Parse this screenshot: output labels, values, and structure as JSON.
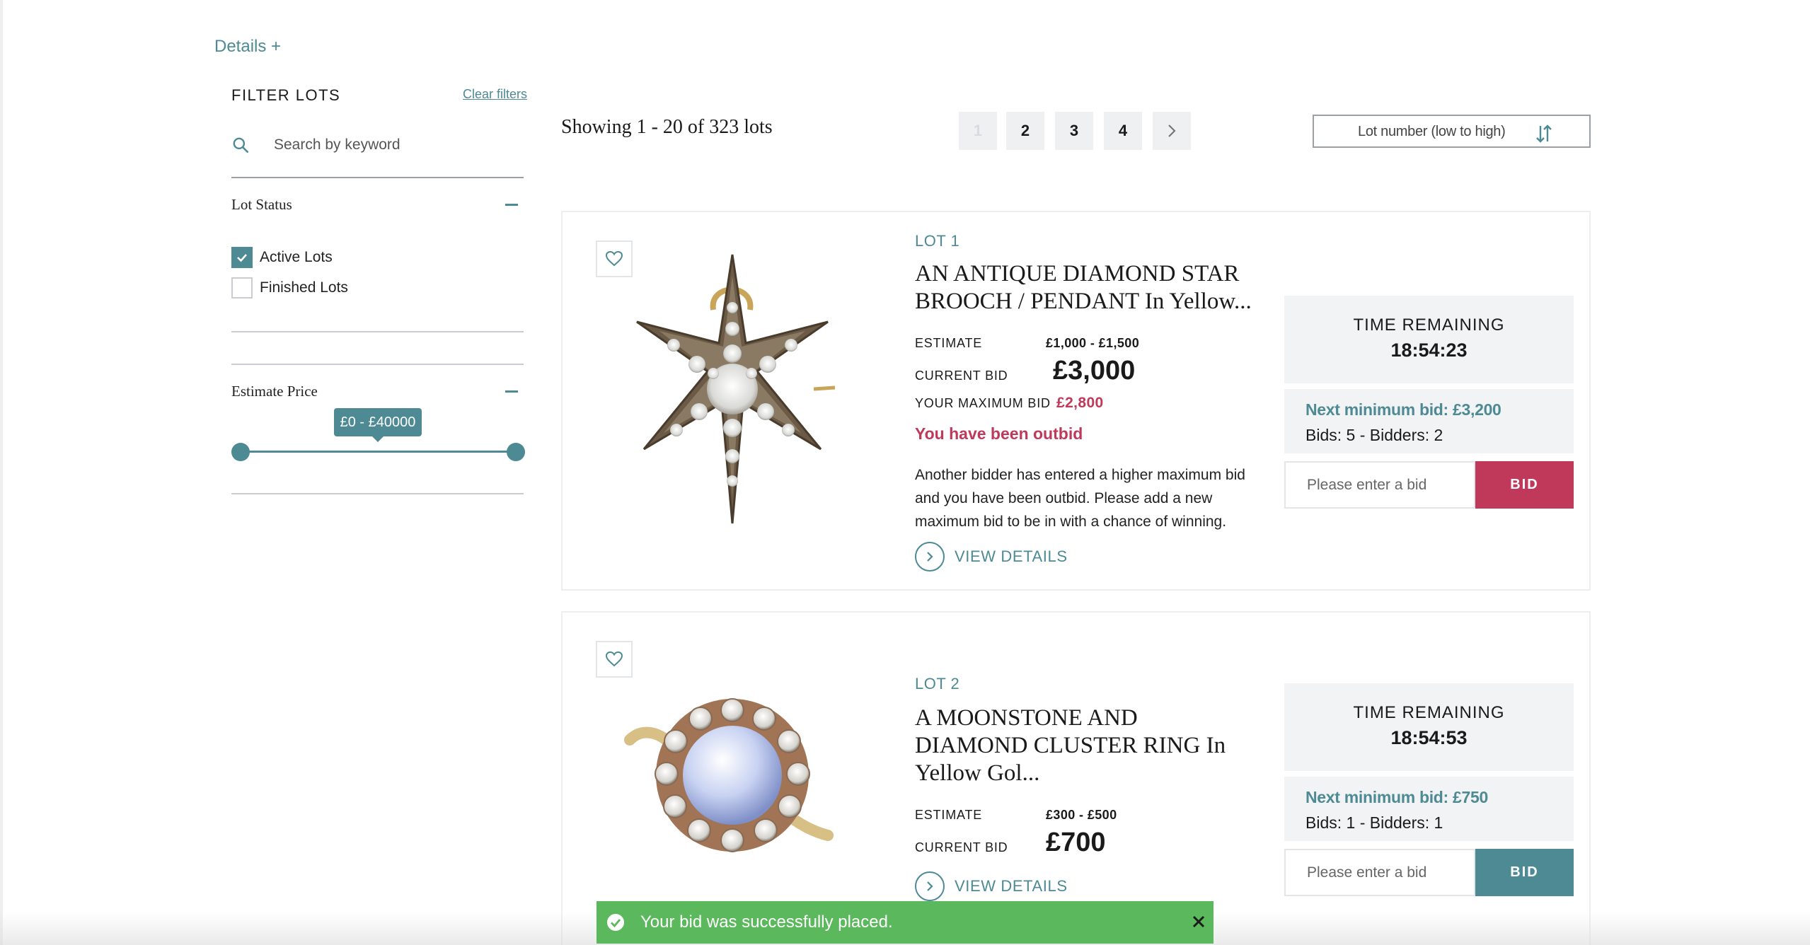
{
  "header": {
    "details_link": "Details +"
  },
  "filters": {
    "title": "FILTER LOTS",
    "clear_label": "Clear filters",
    "search_placeholder": "Search by keyword",
    "lot_status": {
      "title": "Lot Status",
      "options": [
        {
          "label": "Active Lots",
          "checked": true
        },
        {
          "label": "Finished Lots",
          "checked": false
        }
      ]
    },
    "estimate_price": {
      "title": "Estimate Price",
      "range_label": "£0 - £40000",
      "min": 0,
      "max": 40000
    }
  },
  "results": {
    "showing": "Showing 1 - 20 of 323 lots",
    "pages": [
      "1",
      "2",
      "3",
      "4"
    ],
    "current_page": "1",
    "next_icon": "chevron-right-icon",
    "sort_label": "Lot number (low to high)",
    "sort_icon": "sort-arrows-icon"
  },
  "lots": [
    {
      "lot_number": "LOT 1",
      "title": "AN ANTIQUE DIAMOND STAR BROOCH / PENDANT In Yellow...",
      "estimate_label": "ESTIMATE",
      "estimate": "£1,000 - £1,500",
      "current_bid_label": "CURRENT BID",
      "current_bid": "£3,000",
      "max_bid_label": "YOUR MAXIMUM BID",
      "max_bid": "£2,800",
      "status": "You have been outbid",
      "status_message": "Another bidder has entered a higher maximum bid and you have been outbid. Please add a new maximum bid to be in with a chance of winning.",
      "view_details": "VIEW DETAILS",
      "time_label": "TIME REMAINING",
      "time_remaining": "18:54:23",
      "next_min_bid": "Next minimum bid:  £3,200",
      "bids_line": "Bids:  5 - Bidders:  2",
      "bid_placeholder": "Please enter a bid",
      "bid_button": "BID"
    },
    {
      "lot_number": "LOT 2",
      "title": "A MOONSTONE AND DIAMOND CLUSTER RING In Yellow Gol...",
      "estimate_label": "ESTIMATE",
      "estimate": "£300 - £500",
      "current_bid_label": "CURRENT BID",
      "current_bid": "£700",
      "view_details": "VIEW DETAILS",
      "time_label": "TIME REMAINING",
      "time_remaining": "18:54:53",
      "next_min_bid": "Next minimum bid:  £750",
      "bids_line": "Bids:  1 - Bidders:  1",
      "bid_placeholder": "Please enter a bid",
      "bid_button": "BID"
    }
  ],
  "toast": {
    "message": "Your bid was successfully placed."
  },
  "colors": {
    "accent": "#4d8a94",
    "outbid": "#c0395a",
    "success": "#5cb85c"
  }
}
